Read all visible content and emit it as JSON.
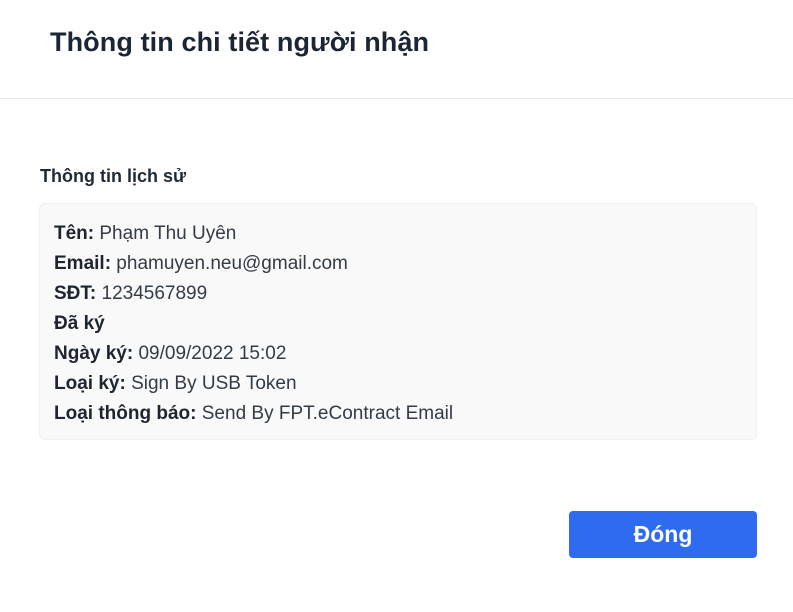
{
  "modal": {
    "title": "Thông tin chi tiết người nhận"
  },
  "history": {
    "section_title": "Thông tin lịch sử",
    "name_label": "Tên:",
    "name_value": " Phạm Thu Uyên",
    "email_label": "Email:",
    "email_value": " phamuyen.neu@gmail.com",
    "phone_label": "SĐT:",
    "phone_value": " 1234567899",
    "status_label": "Đã ký",
    "sign_date_label": "Ngày ký:",
    "sign_date_value": " 09/09/2022 15:02",
    "sign_type_label": "Loại ký:",
    "sign_type_value": " Sign By USB Token",
    "notify_type_label": "Loại thông báo:",
    "notify_type_value": " Send By FPT.eContract Email"
  },
  "footer": {
    "close_label": "Đóng",
    "close_color": "#2f6bf0"
  }
}
